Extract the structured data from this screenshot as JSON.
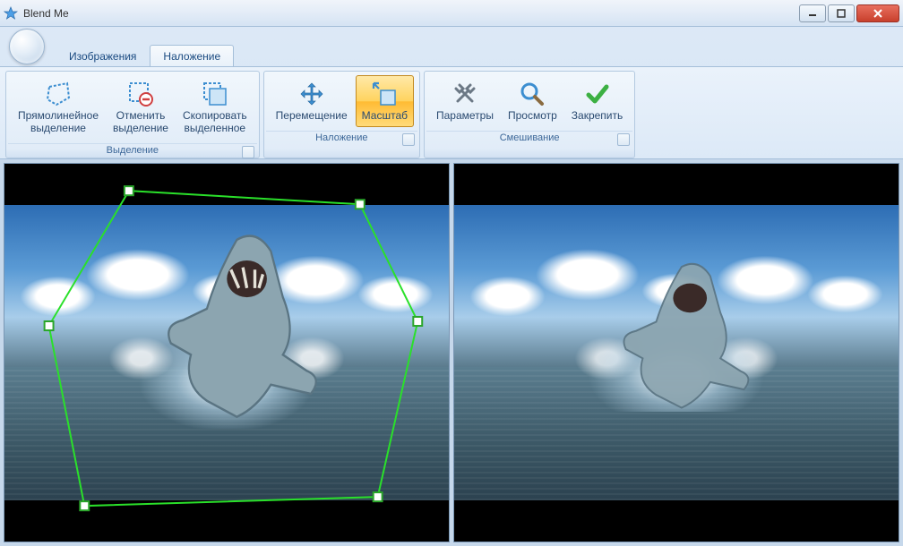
{
  "window": {
    "title": "Blend Me"
  },
  "tabs": {
    "images": "Изображения",
    "overlay": "Наложение"
  },
  "ribbon": {
    "selection": {
      "label": "Выделение",
      "rectilinear": "Прямолинейное\nвыделение",
      "cancel": "Отменить\nвыделение",
      "copy": "Скопировать\nвыделенное"
    },
    "overlay": {
      "label": "Наложение",
      "move": "Перемещение",
      "scale": "Масштаб"
    },
    "blending": {
      "label": "Смешивание",
      "params": "Параметры",
      "preview": "Просмотр",
      "commit": "Закрепить"
    }
  }
}
